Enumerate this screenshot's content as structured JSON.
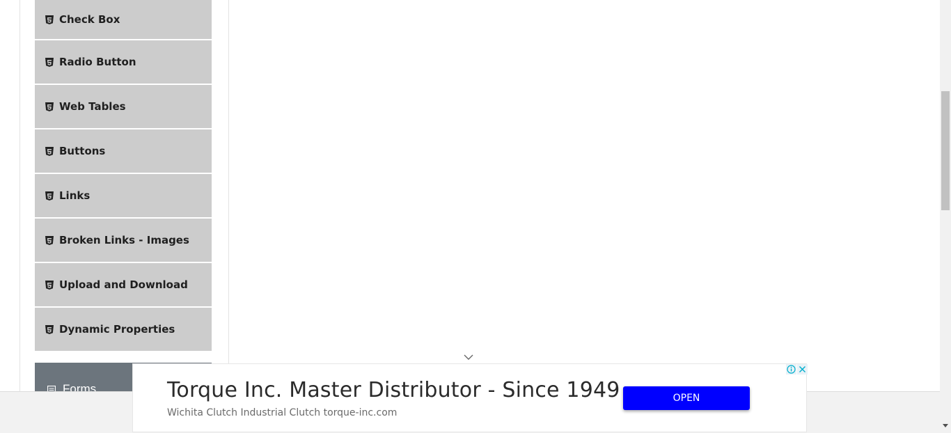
{
  "sidebar": {
    "items": [
      {
        "label": "Check Box",
        "icon": "html5-icon"
      },
      {
        "label": "Radio Button",
        "icon": "html5-icon"
      },
      {
        "label": "Web Tables",
        "icon": "html5-icon"
      },
      {
        "label": "Buttons",
        "icon": "html5-icon"
      },
      {
        "label": "Links",
        "icon": "html5-icon"
      },
      {
        "label": "Broken Links - Images",
        "icon": "html5-icon"
      },
      {
        "label": "Upload and Download",
        "icon": "html5-icon"
      },
      {
        "label": "Dynamic Properties",
        "icon": "html5-icon"
      }
    ],
    "next_group": {
      "label": "Forms",
      "icon": "form-icon"
    }
  },
  "ad": {
    "title": "Torque Inc. Master Distributor - Since 1949",
    "subtitle": "Wichita Clutch Industrial Clutch torque-inc.com",
    "button_label": "OPEN",
    "button_color": "#0000ff"
  },
  "colors": {
    "menu_item_bg": "#cccccc",
    "group_header_bg": "#6c757d"
  }
}
